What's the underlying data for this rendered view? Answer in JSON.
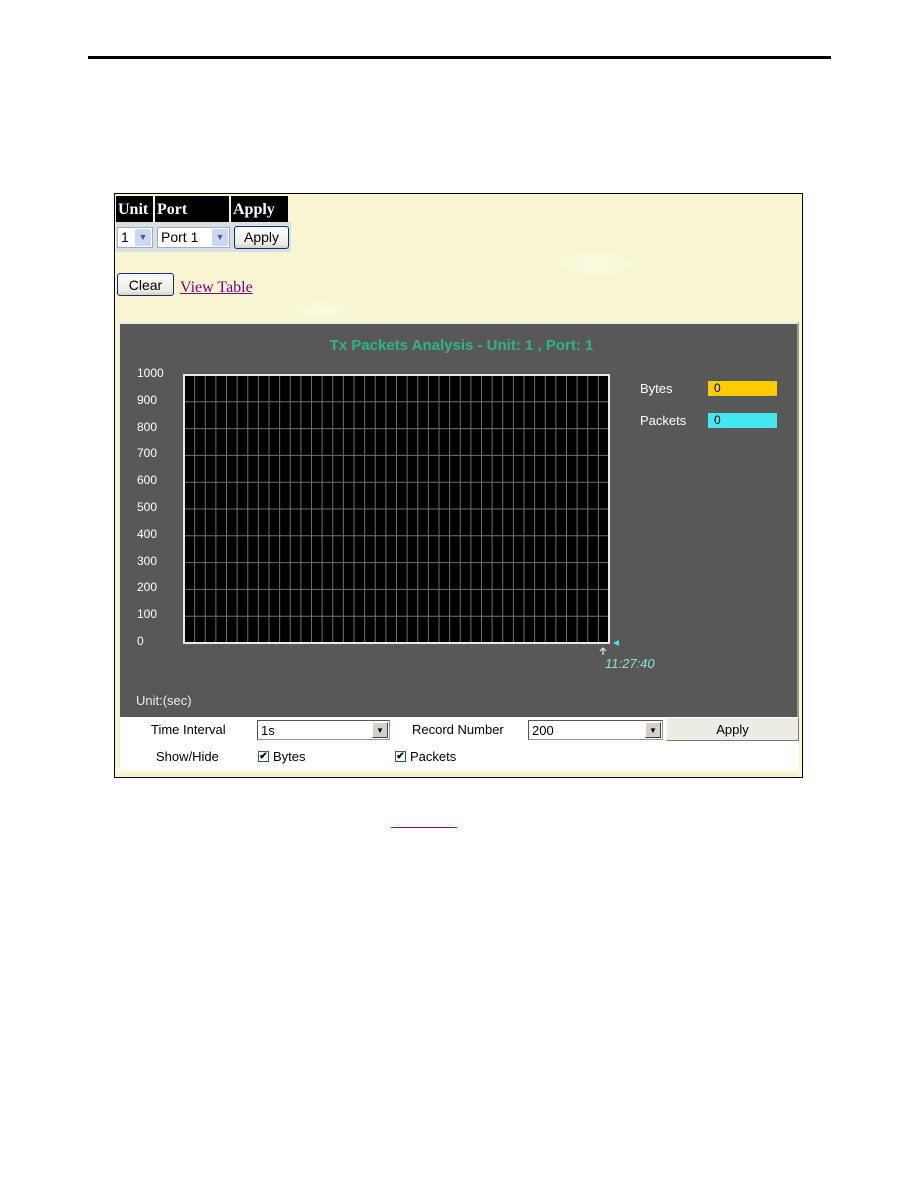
{
  "selector": {
    "headers": [
      "Unit",
      "Port",
      "Apply"
    ],
    "unit_value": "1",
    "port_value": "Port 1",
    "apply_label": "Apply"
  },
  "actions": {
    "clear_label": "Clear",
    "view_table_label": "View Table"
  },
  "chart_data": {
    "type": "line",
    "title": "Tx Packets Analysis - Unit: 1 , Port: 1",
    "ylim": [
      0,
      1000
    ],
    "y_ticks": [
      "1000",
      "900",
      "800",
      "700",
      "600",
      "500",
      "400",
      "300",
      "200",
      "100",
      "0"
    ],
    "grid": true,
    "x_divisions": 40,
    "xlabel": "Unit:(sec)",
    "time_marker": "11:27:40",
    "series": [
      {
        "name": "Bytes",
        "color": "#ffcc00",
        "current_value": "0",
        "values": []
      },
      {
        "name": "Packets",
        "color": "#44e6f2",
        "current_value": "0",
        "values": []
      }
    ],
    "legend_position": "right"
  },
  "controls": {
    "time_interval_label": "Time Interval",
    "time_interval_value": "1s",
    "record_number_label": "Record Number",
    "record_number_value": "200",
    "apply_label": "Apply",
    "show_hide_label": "Show/Hide",
    "show_bytes_label": "Bytes",
    "show_bytes_checked": true,
    "show_packets_label": "Packets",
    "show_packets_checked": true,
    "check_glyph": "✔"
  },
  "icons": {
    "dropdown_glyph": "▼",
    "blue_dropdown_glyph": "⌄"
  }
}
